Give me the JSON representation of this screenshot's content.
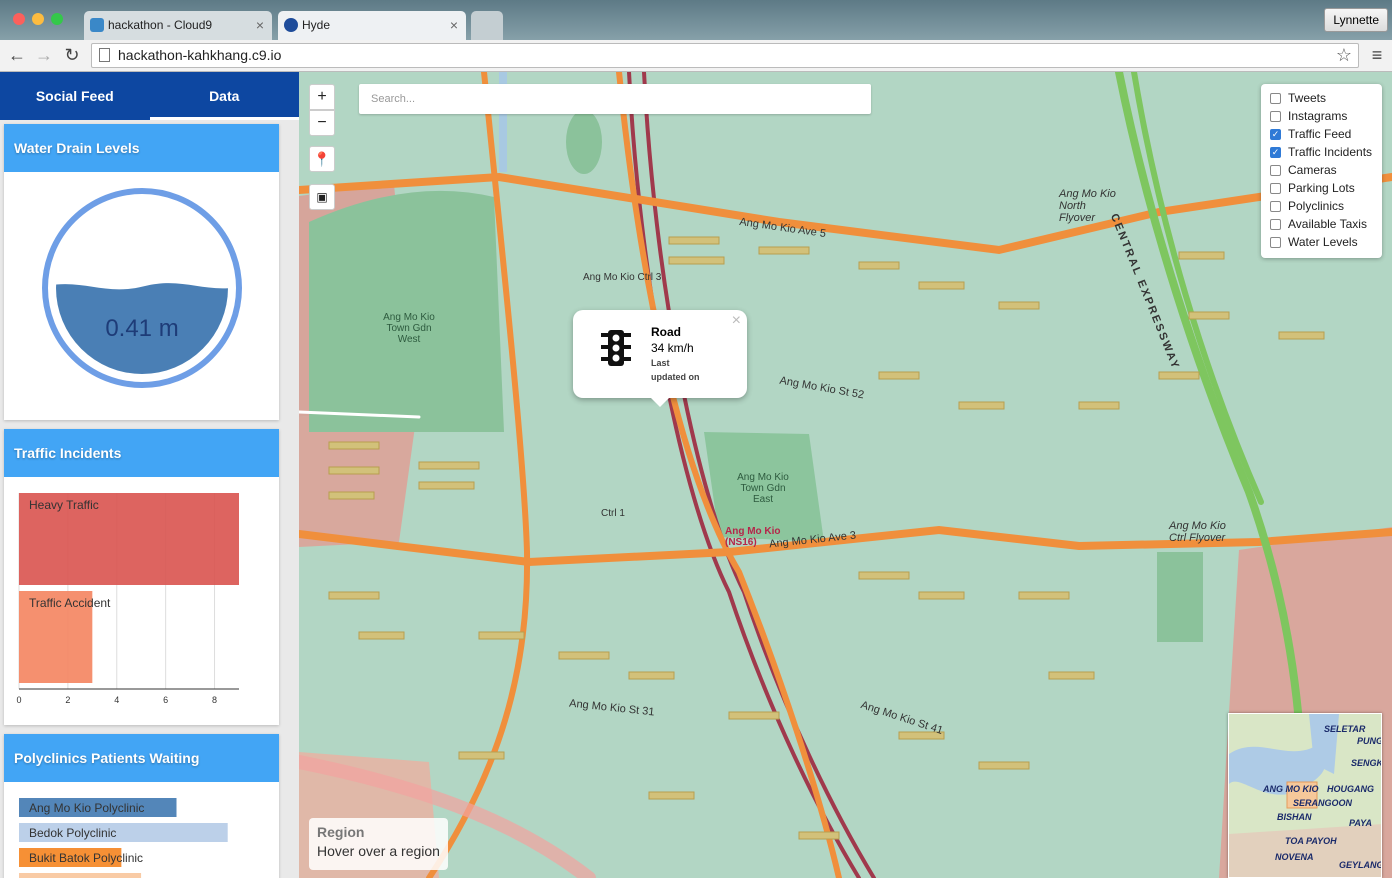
{
  "browser": {
    "tabs": [
      {
        "title": "hackathon - Cloud9"
      },
      {
        "title": "Hyde"
      }
    ],
    "user": "Lynnette",
    "url": "hackathon-kahkhang.c9.io"
  },
  "sidebar": {
    "tabs": [
      {
        "label": "Social Feed",
        "active": false
      },
      {
        "label": "Data",
        "active": true
      }
    ],
    "water": {
      "title": "Water Drain Levels",
      "value": "0.41 m",
      "fill_fraction": 0.41
    },
    "incidents": {
      "title": "Traffic Incidents",
      "chart_data": {
        "type": "bar",
        "orientation": "horizontal",
        "categories": [
          "Heavy Traffic",
          "Traffic Accident"
        ],
        "values": [
          9,
          3
        ],
        "xlim": [
          0,
          9
        ],
        "xticks": [
          "0",
          "2",
          "4",
          "6",
          "8"
        ],
        "colors": [
          "#d9534f",
          "#f4845f"
        ]
      }
    },
    "polyclinics": {
      "title": "Polyclinics Patients Waiting",
      "chart_data": {
        "type": "bar",
        "orientation": "horizontal",
        "categories": [
          "Ang Mo Kio Polyclinic",
          "Bedok Polyclinic",
          "Bukit Batok Polyclinic",
          ""
        ],
        "values": [
          40,
          53,
          26,
          31
        ],
        "colors": [
          "#4a7fb5",
          "#b8cde8",
          "#f58a2a",
          "#f9c8a0"
        ]
      }
    }
  },
  "map": {
    "zoom_in": "+",
    "zoom_out": "−",
    "search_placeholder": "Search...",
    "layers": [
      {
        "label": "Tweets",
        "checked": false
      },
      {
        "label": "Instagrams",
        "checked": false
      },
      {
        "label": "Traffic Feed",
        "checked": true
      },
      {
        "label": "Traffic Incidents",
        "checked": true
      },
      {
        "label": "Cameras",
        "checked": false
      },
      {
        "label": "Parking Lots",
        "checked": false
      },
      {
        "label": "Polyclinics",
        "checked": false
      },
      {
        "label": "Available Taxis",
        "checked": false
      },
      {
        "label": "Water Levels",
        "checked": false
      }
    ],
    "popup": {
      "title": "Road",
      "speed": "34 km/h",
      "last": "Last",
      "updated": "updated on",
      "close": "×",
      "icon": "traffic-light-icon"
    },
    "region": {
      "title": "Region",
      "text": "Hover over a region"
    },
    "labels": {
      "gdn_west": "Ang Mo Kio Town Gdn West",
      "gdn_east": "Ang Mo Kio Town Gdn East",
      "station": "Ang Mo Kio (NS16)",
      "flyover": "Ang Mo Kio North Flyover",
      "ctrl_flyover": "Ang Mo Kio Ctrl Flyover",
      "cte": "CENTRAL EXPRESSWAY",
      "ave5": "Ang Mo Kio Ave 5",
      "ave3": "Ang Mo Kio Ave 3",
      "st52": "Ang Mo Kio St 52",
      "st31": "Ang Mo Kio St 31",
      "st41": "Ang Mo Kio St 41",
      "ctrl3": "Ang Mo Kio Ctrl 3",
      "ctrl1": "Ctrl 1"
    },
    "minimap": {
      "labels": [
        "SELETAR",
        "PUNG",
        "SENGK",
        "ANG MO KIO",
        "HOUGANG",
        "SERANGOON",
        "BISHAN",
        "TOA PAYOH",
        "NOVENA",
        "GEYLANG",
        "PAYA"
      ]
    }
  }
}
